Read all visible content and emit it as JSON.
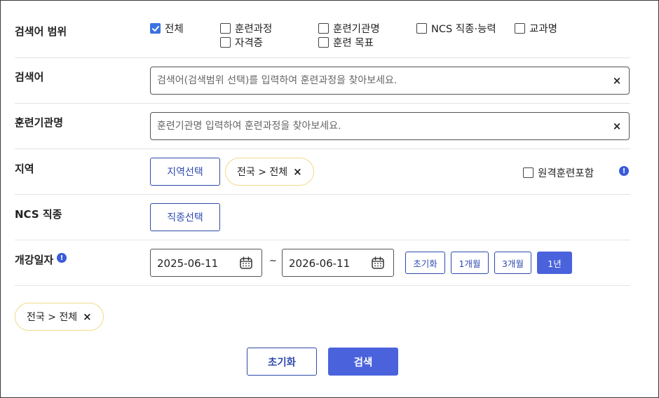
{
  "scope": {
    "label": "검색어 범위",
    "options": [
      {
        "label": "전체",
        "checked": true
      },
      {
        "label": "훈련과정",
        "checked": false
      },
      {
        "label": "훈련기관명",
        "checked": false
      },
      {
        "label": "NCS 직종·능력",
        "checked": false
      },
      {
        "label": "교과명",
        "checked": false
      },
      {
        "label": "자격증",
        "checked": false
      },
      {
        "label": "훈련 목표",
        "checked": false
      }
    ]
  },
  "keyword": {
    "label": "검색어",
    "placeholder": "검색어(검색범위 선택)를 입력하여 훈련과정을 찾아보세요.",
    "value": "",
    "clear": "×"
  },
  "institution": {
    "label": "훈련기관명",
    "placeholder": "훈련기관명 입력하여 훈련과정을 찾아보세요.",
    "value": "",
    "clear": "×"
  },
  "region": {
    "label": "지역",
    "select_button": "지역선택",
    "chip": "전국 > 전체",
    "chip_close": "×",
    "remote_label": "원격훈련포함",
    "remote_checked": false,
    "info": "!"
  },
  "ncs": {
    "label": "NCS 직종",
    "select_button": "직종선택"
  },
  "period": {
    "label": "개강일자",
    "info": "!",
    "start": "2025-06-11",
    "tilde": "~",
    "end": "2026-06-11",
    "reset": "초기화",
    "one_month": "1개월",
    "three_months": "3개월",
    "one_year": "1년",
    "active": "1년"
  },
  "summary": {
    "chip": "전국 > 전체",
    "chip_close": "×"
  },
  "actions": {
    "reset": "초기화",
    "search": "검색"
  },
  "colors": {
    "accent": "#4a63dc",
    "checkbox": "#3b73e0",
    "chip_border": "#f2d98a",
    "divider": "#e3e3e3"
  }
}
